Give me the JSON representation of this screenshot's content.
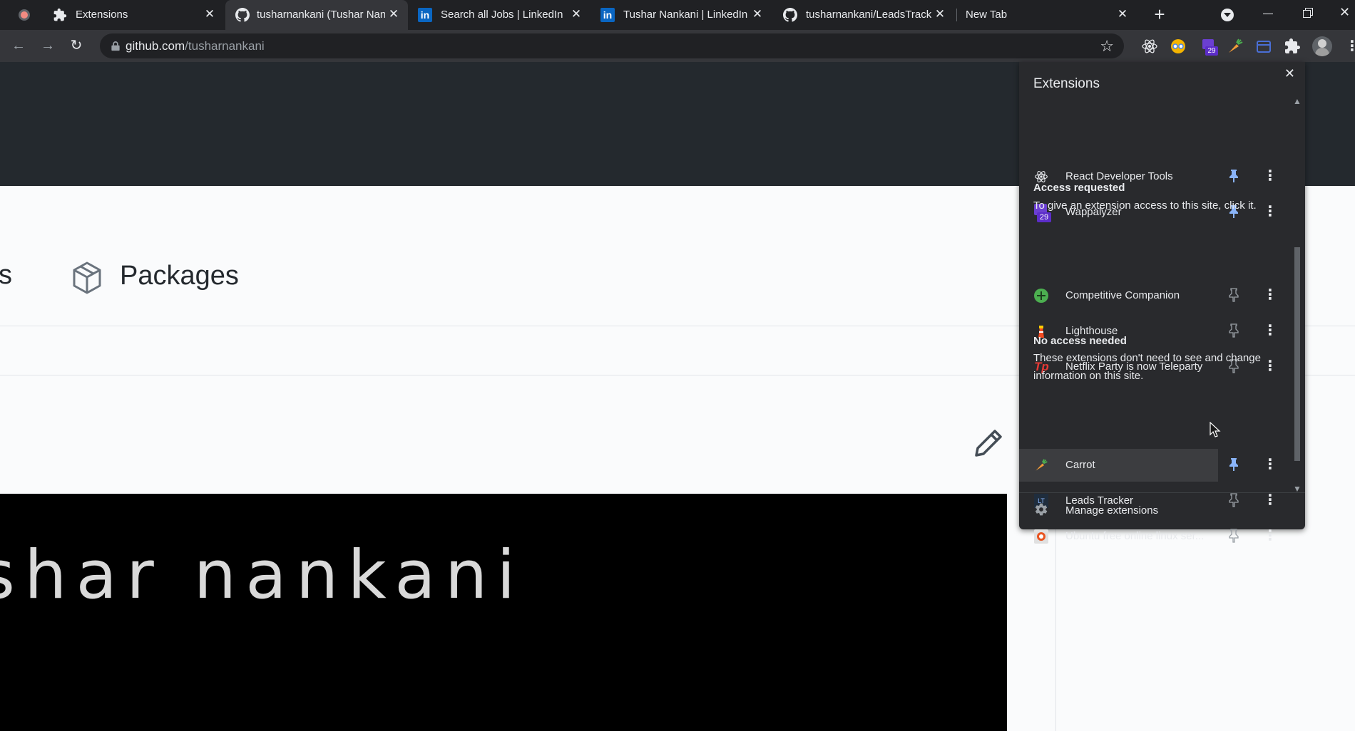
{
  "browser": {
    "tabs": [
      {
        "title": "Extensions",
        "icon": "puzzle-icon",
        "active": false
      },
      {
        "title": "tusharnankani (Tushar Nan",
        "icon": "github-icon",
        "active": true
      },
      {
        "title": "Search all Jobs | LinkedIn",
        "icon": "linkedin-icon",
        "active": false
      },
      {
        "title": "Tushar Nankani | LinkedIn",
        "icon": "linkedin-icon",
        "active": false
      },
      {
        "title": "tusharnankani/LeadsTracke",
        "icon": "github-icon",
        "active": false
      },
      {
        "title": "New Tab",
        "icon": "",
        "active": false
      }
    ],
    "new_tab_symbol": "+",
    "url_host": "github.com",
    "url_path": "/tusharnankani",
    "pinned_badge_count": "29"
  },
  "page": {
    "nav_partial": "s",
    "packages_label": "Packages",
    "banner_text": "shar nankani"
  },
  "extensions_popup": {
    "title": "Extensions",
    "pinned": [
      {
        "name": "React Developer Tools",
        "pinned": true,
        "icon": "react-icon"
      },
      {
        "name": "Wappalyzer",
        "pinned": true,
        "icon": "wappalyzer-icon",
        "badge": "29"
      }
    ],
    "access_requested": {
      "title": "Access requested",
      "description": "To give an extension access to this site, click it.",
      "items": [
        {
          "name": "Competitive Companion",
          "pinned": false,
          "icon": "competitive-companion-icon"
        },
        {
          "name": "Lighthouse",
          "pinned": false,
          "icon": "lighthouse-icon"
        },
        {
          "name": "Netflix Party is now Teleparty",
          "pinned": false,
          "icon": "teleparty-icon"
        }
      ]
    },
    "no_access": {
      "title": "No access needed",
      "description": "These extensions don't need to see and change information on this site.",
      "items": [
        {
          "name": "Carrot",
          "pinned": true,
          "icon": "carrot-icon"
        },
        {
          "name": "Leads Tracker",
          "pinned": false,
          "icon": "leads-tracker-icon"
        },
        {
          "name": "Ubuntu free online linux ser...",
          "pinned": false,
          "icon": "ubuntu-icon"
        }
      ]
    },
    "manage_label": "Manage extensions"
  },
  "colors": {
    "tabstrip_bg": "#202124",
    "toolbar_bg": "#35363a",
    "popup_bg": "#292a2d",
    "pinned_pin_color": "#8ab4f8",
    "unpinned_pin_color": "#9aa0a6"
  }
}
